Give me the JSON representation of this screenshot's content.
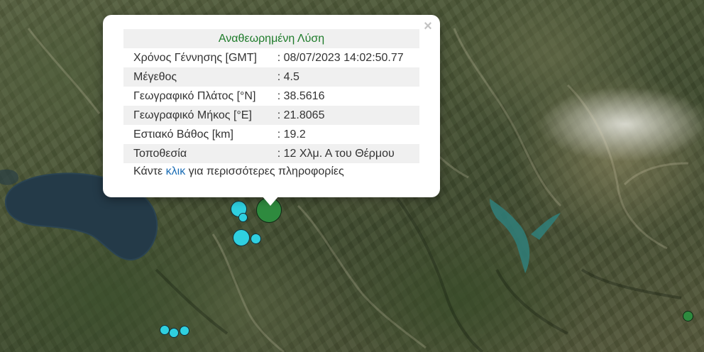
{
  "popup": {
    "title": "Αναθεωρημένη Λύση",
    "close_label": "×",
    "rows": [
      {
        "label": "Χρόνος Γέννησης [GMT]",
        "value": ": 08/07/2023 14:02:50.77"
      },
      {
        "label": "Μέγεθος",
        "value": ": 4.5"
      },
      {
        "label": "Γεωγραφικό Πλάτος [°N]",
        "value": ": 38.5616"
      },
      {
        "label": "Γεωγραφικό Μήκος [°E]",
        "value": ": 21.8065"
      },
      {
        "label": "Εστιακό Βάθος [km]",
        "value": ": 19.2"
      },
      {
        "label": "Τοποθεσία",
        "value": ": 12 Χλμ. Α του Θέρμου"
      }
    ],
    "more_prefix": "Κάντε",
    "more_link": "κλικ",
    "more_suffix": "για περισσότερες πληροφορίες"
  },
  "colors": {
    "title": "#1e7b2a",
    "link": "#1a6db5",
    "recent_event": "#2fd0e0",
    "selected_event": "#2e8a3e",
    "lake": "#243a48",
    "reservoir": "#2f7f7a"
  },
  "map": {
    "markers": [
      {
        "kind": "selected"
      },
      {
        "kind": "recent"
      },
      {
        "kind": "recent"
      },
      {
        "kind": "recent"
      },
      {
        "kind": "recent"
      },
      {
        "kind": "recent"
      },
      {
        "kind": "recent"
      },
      {
        "kind": "recent"
      },
      {
        "kind": "selected-small"
      }
    ]
  }
}
